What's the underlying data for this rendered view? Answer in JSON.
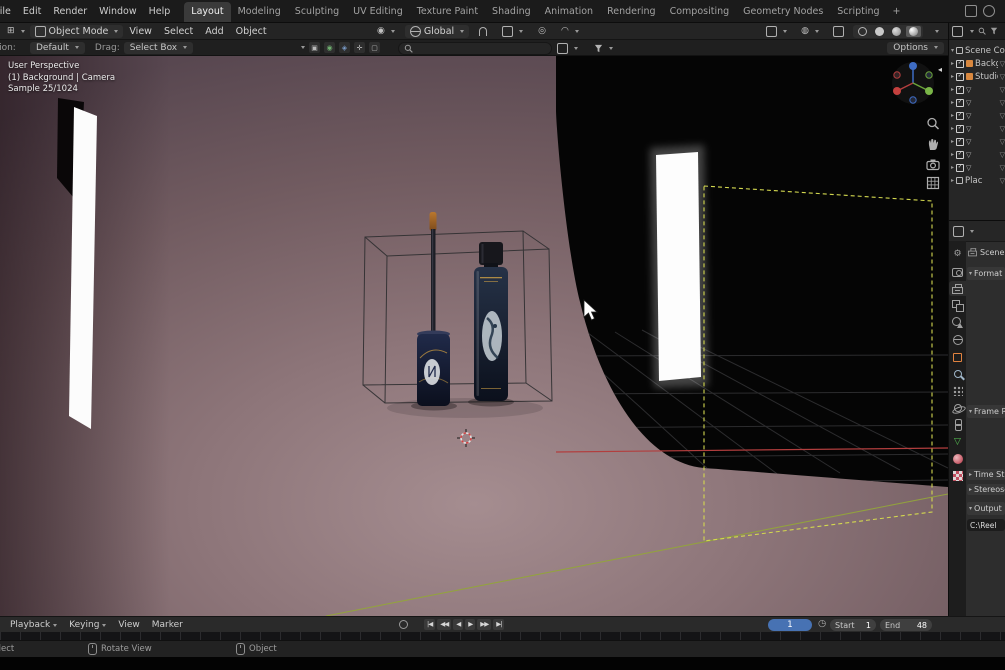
{
  "topbar": {
    "menus": [
      "File",
      "Edit",
      "Render",
      "Window",
      "Help"
    ],
    "workspaces": [
      "Layout",
      "Modeling",
      "Sculpting",
      "UV Editing",
      "Texture Paint",
      "Shading",
      "Animation",
      "Rendering",
      "Compositing",
      "Geometry Nodes",
      "Scripting"
    ],
    "active_workspace": "Layout",
    "new_workspace": "+"
  },
  "viewport_header": {
    "mode": "Object Mode",
    "menus": [
      "View",
      "Select",
      "Add",
      "Object"
    ],
    "orientation": "Global"
  },
  "tool_settings": {
    "orientation_label": "Orientation:",
    "orientation_value": "Default",
    "drag_label": "Drag:",
    "drag_value": "Select Box",
    "options": "Options"
  },
  "viewport": {
    "view_label": "User Perspective",
    "context_label": "(1) Background | Camera",
    "sample_label": "Sample 25/1024"
  },
  "outliner": {
    "rows": [
      "Scene Collection",
      "Background",
      "Studio",
      "",
      "",
      "",
      "",
      "",
      "",
      "",
      "Plac"
    ]
  },
  "properties": {
    "breadcrumb": "Scene",
    "panels": {
      "format": "Format",
      "frame_range": "Frame Range",
      "time_stretching": "Time Stretching",
      "stereoscopy": "Stereoscopy",
      "output": "Output"
    },
    "output_path": "C:\\Reel"
  },
  "timeline": {
    "menus": [
      "Playback",
      "Keying",
      "View",
      "Marker"
    ],
    "transport": [
      "|◀",
      "◀◀",
      "◀",
      "▶",
      "▶▶",
      "▶|"
    ],
    "current_frame": "1",
    "start_label": "Start",
    "start_value": "1",
    "end_label": "End",
    "end_value": "48"
  },
  "statusbar": {
    "left_hint": "Select",
    "hint_rotate": "Rotate View",
    "hint_object": "Object"
  },
  "colors": {
    "accent_blue": "#4772b3",
    "axis_red": "#b23e3e",
    "axis_green": "#93a43c",
    "camera_dash_yellow": "#d3d84f",
    "collection_orange": "#d9883f"
  }
}
